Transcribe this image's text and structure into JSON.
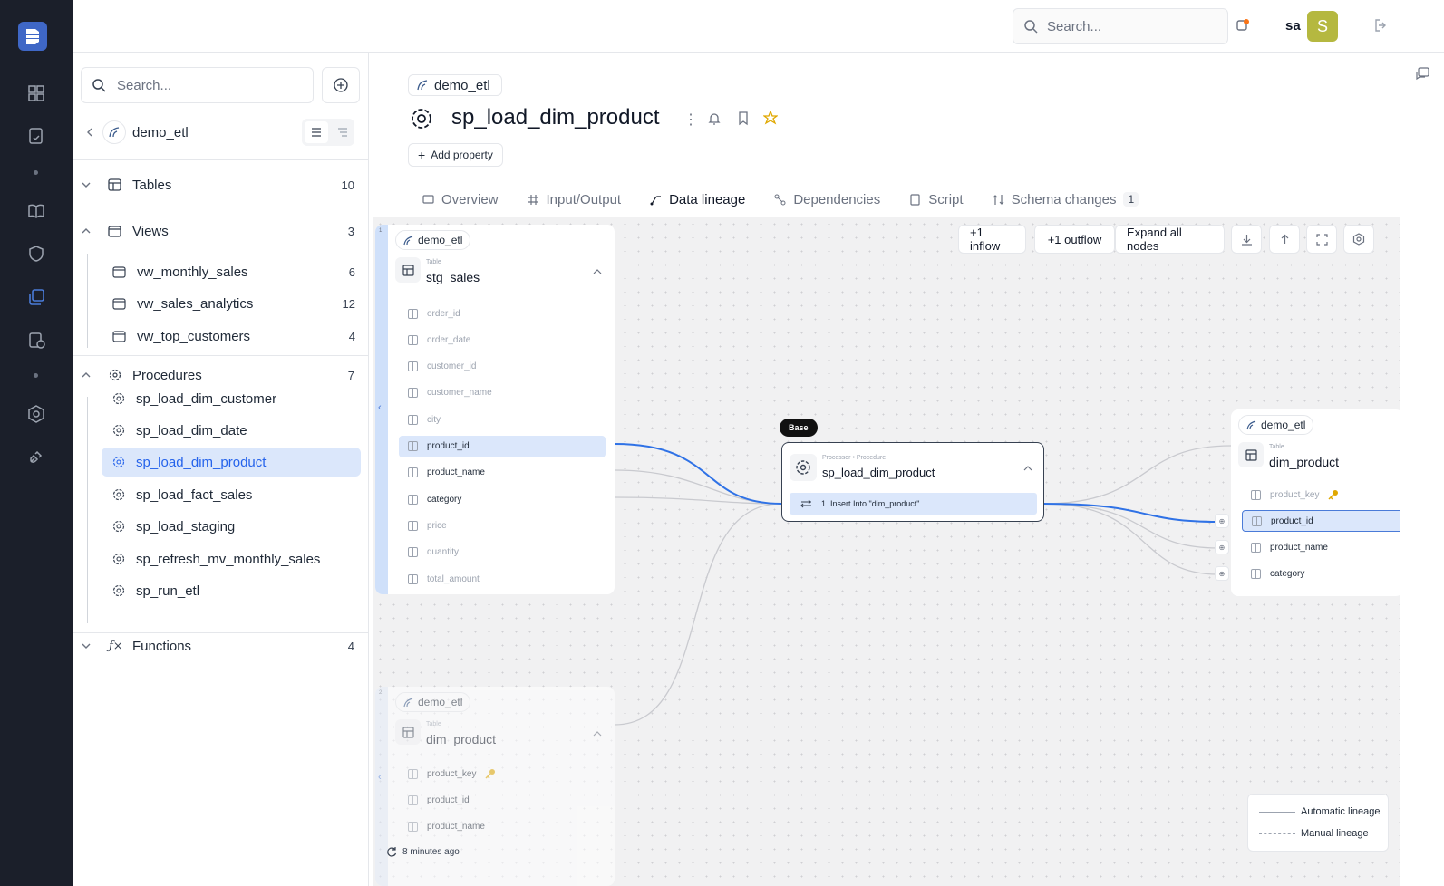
{
  "topbar": {
    "search_placeholder": "Search...",
    "user_name": "sa",
    "avatar_initial": "S"
  },
  "sidebar": {
    "search_placeholder": "Search...",
    "database": "demo_etl",
    "sections": {
      "tables": {
        "label": "Tables",
        "count": "10"
      },
      "views": {
        "label": "Views",
        "count": "3",
        "items": [
          {
            "label": "vw_monthly_sales",
            "count": "6"
          },
          {
            "label": "vw_sales_analytics",
            "count": "12"
          },
          {
            "label": "vw_top_customers",
            "count": "4"
          }
        ]
      },
      "procedures": {
        "label": "Procedures",
        "count": "7",
        "items": [
          {
            "label": "sp_load_dim_customer"
          },
          {
            "label": "sp_load_dim_date"
          },
          {
            "label": "sp_load_dim_product"
          },
          {
            "label": "sp_load_fact_sales"
          },
          {
            "label": "sp_load_staging"
          },
          {
            "label": "sp_refresh_mv_monthly_sales"
          },
          {
            "label": "sp_run_etl"
          }
        ]
      },
      "functions": {
        "label": "Functions",
        "count": "4"
      }
    }
  },
  "header": {
    "breadcrumb": "demo_etl",
    "title": "sp_load_dim_product",
    "add_property": "Add property"
  },
  "tabs": [
    {
      "label": "Overview"
    },
    {
      "label": "Input/Output"
    },
    {
      "label": "Data lineage"
    },
    {
      "label": "Dependencies"
    },
    {
      "label": "Script"
    },
    {
      "label": "Schema changes",
      "badge": "1"
    }
  ],
  "toolbar": {
    "inflow": "+1 inflow",
    "outflow": "+1 outflow",
    "expand": "Expand all nodes"
  },
  "nodes": {
    "stg_sales": {
      "schema": "demo_etl",
      "type": "Table",
      "name": "stg_sales",
      "index": "1",
      "columns": [
        "order_id",
        "order_date",
        "customer_id",
        "customer_name",
        "city",
        "product_id",
        "product_name",
        "category",
        "price",
        "quantity",
        "total_amount"
      ]
    },
    "base": {
      "badge": "Base",
      "type": "Processor • Procedure",
      "name": "sp_load_dim_product",
      "statement": "1. Insert Into \"dim_product\""
    },
    "dim_product_out": {
      "schema": "demo_etl",
      "type": "Table",
      "name": "dim_product",
      "columns": [
        "product_key",
        "product_id",
        "product_name",
        "category"
      ]
    },
    "dim_product_in": {
      "schema": "demo_etl",
      "type": "Table",
      "name": "dim_product",
      "index": "2",
      "columns": [
        "product_key",
        "product_id",
        "product_name"
      ]
    }
  },
  "legend": {
    "automatic": "Automatic lineage",
    "manual": "Manual lineage"
  },
  "status": {
    "updated": "8 minutes ago"
  }
}
